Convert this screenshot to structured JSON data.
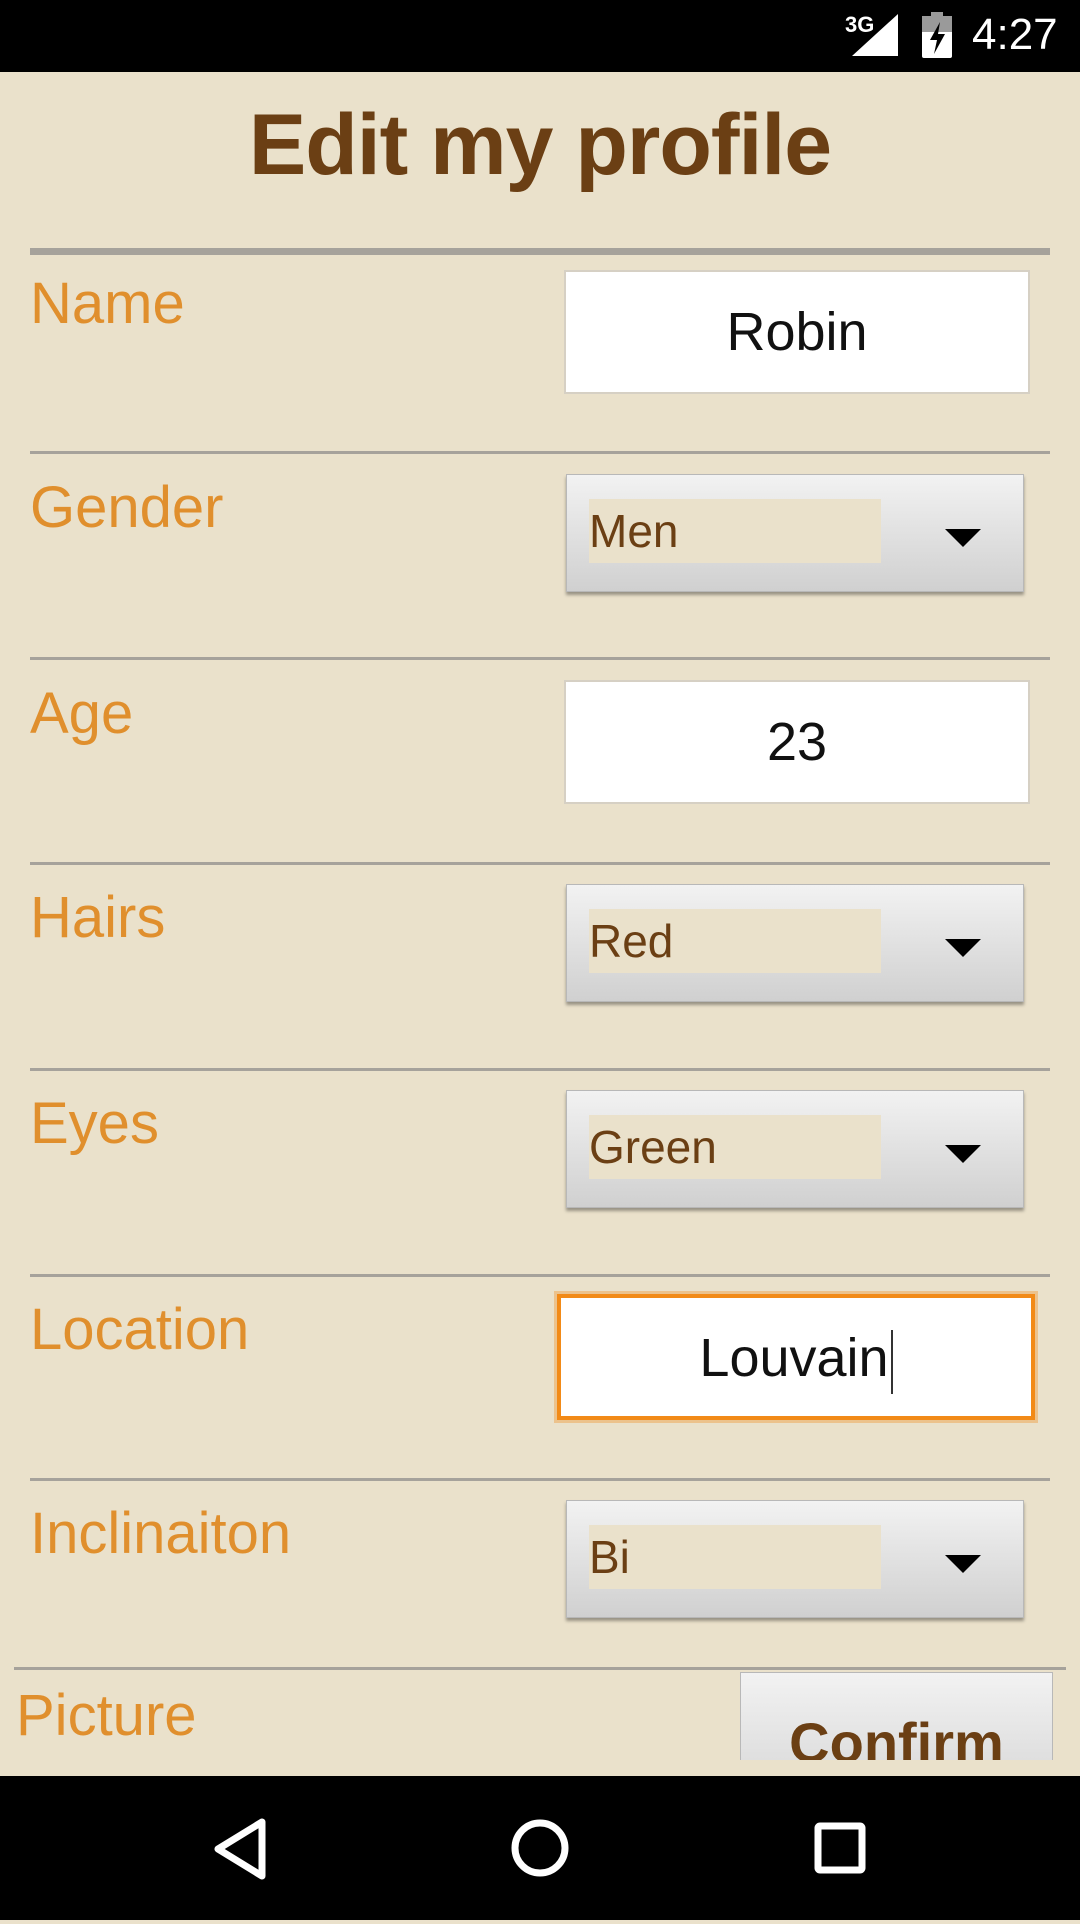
{
  "status_bar": {
    "network": "3G",
    "time": "4:27",
    "icons": [
      "signal-icon",
      "battery-icon"
    ]
  },
  "title": "Edit my profile",
  "fields": {
    "name": {
      "label": "Name",
      "value": "Robin"
    },
    "gender": {
      "label": "Gender",
      "value": "Men"
    },
    "age": {
      "label": "Age",
      "value": "23"
    },
    "hairs": {
      "label": "Hairs",
      "value": "Red"
    },
    "eyes": {
      "label": "Eyes",
      "value": "Green"
    },
    "location": {
      "label": "Location",
      "value": "Louvain"
    },
    "inclination": {
      "label": "Inclinaiton",
      "value": "Bi"
    },
    "picture": {
      "label": "Picture"
    }
  },
  "confirm_label": "Confirm",
  "nav": {
    "icons": [
      "back-icon",
      "home-icon",
      "recents-icon"
    ]
  },
  "colors": {
    "background": "#eae1cb",
    "title": "#6b3f14",
    "label": "#e08f2d",
    "focus": "#f28a17"
  }
}
